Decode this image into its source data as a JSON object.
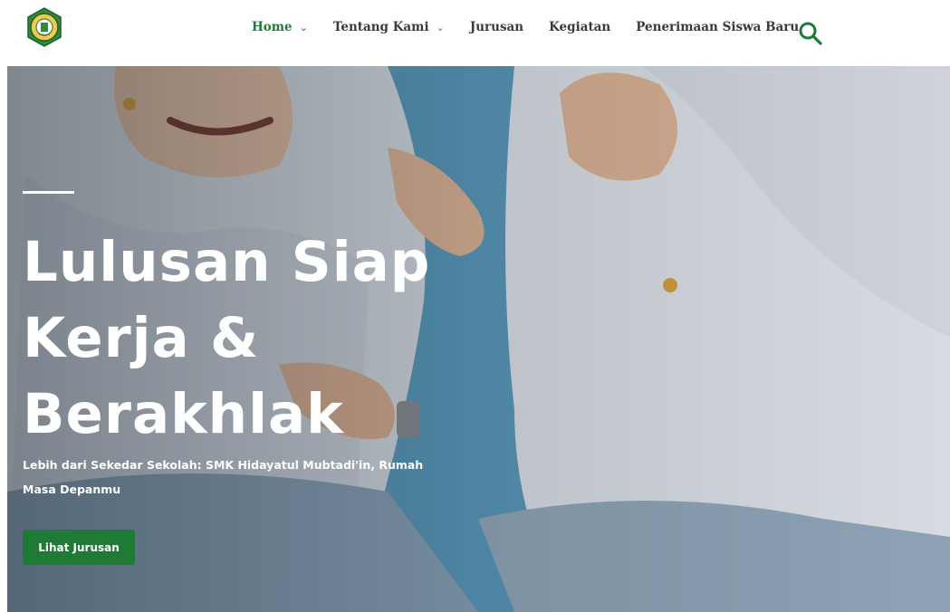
{
  "nav": {
    "logo_name": "school-logo",
    "items": [
      {
        "label": "Home",
        "has_dropdown": true,
        "active": true
      },
      {
        "label": "Tentang Kami",
        "has_dropdown": true,
        "active": false
      },
      {
        "label": "Jurusan",
        "has_dropdown": false,
        "active": false
      },
      {
        "label": "Kegiatan",
        "has_dropdown": false,
        "active": false
      },
      {
        "label": "Penerimaan Siswa Baru",
        "has_dropdown": false,
        "active": false
      }
    ],
    "search_icon": "search-icon"
  },
  "hero": {
    "title": "Lulusan Siap Kerja & Berakhlak",
    "subtitle": "Lebih dari Sekedar Sekolah: SMK Hidayatul Mubtadi'in, Rumah Masa Depanmu",
    "button_label": "Lihat Jurusan"
  },
  "colors": {
    "accent": "#1e7a35",
    "nav_text": "#3a3a3a",
    "hero_text": "#ffffff"
  }
}
